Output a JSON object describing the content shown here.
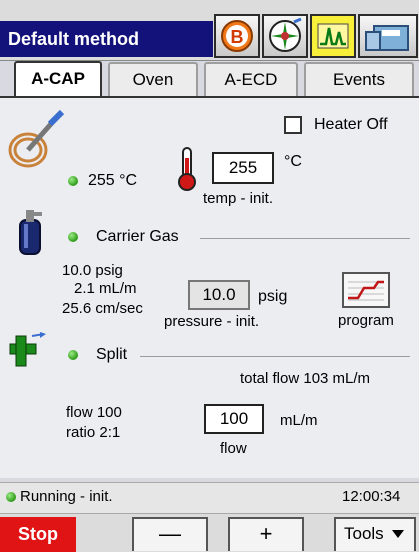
{
  "header": {
    "title": "Default method",
    "buttons": [
      {
        "name": "b-icon",
        "letter": "B"
      },
      {
        "name": "dial-icon"
      },
      {
        "name": "chromatogram-icon"
      },
      {
        "name": "instrument-icon"
      }
    ]
  },
  "tabs": [
    {
      "label": "A-CAP",
      "active": true
    },
    {
      "label": "Oven"
    },
    {
      "label": "A-ECD"
    },
    {
      "label": "Events"
    }
  ],
  "heater": {
    "label": "Heater Off",
    "checked": false
  },
  "temperature": {
    "actual": "255 °C",
    "setpoint": "255",
    "unit": "°C",
    "caption": "temp - init."
  },
  "carrier": {
    "title": "Carrier Gas",
    "pressure_actual": "10.0 psig",
    "flow_actual": "2.1 mL/m",
    "velocity_actual": "25.6 cm/sec",
    "pressure_setpoint": "10.0",
    "pressure_unit": "psig",
    "pressure_caption": "pressure - init.",
    "program_label": "program"
  },
  "split": {
    "title": "Split",
    "total_flow": "total flow  103 mL/m",
    "flow_actual": "flow 100",
    "ratio": "ratio 2:1",
    "flow_setpoint": "100",
    "flow_unit": "mL/m",
    "flow_caption": "flow"
  },
  "status": {
    "text": "Running - init.",
    "time": "12:00:34"
  },
  "toolbar": {
    "stop": "Stop",
    "minus": "—",
    "plus": "+",
    "tools": "Tools"
  },
  "colors": {
    "title_bg": "#12127a",
    "stop_bg": "#e01414",
    "led_green": "#2d9a18",
    "chrom_btn_bg": "#f7ef3a"
  }
}
